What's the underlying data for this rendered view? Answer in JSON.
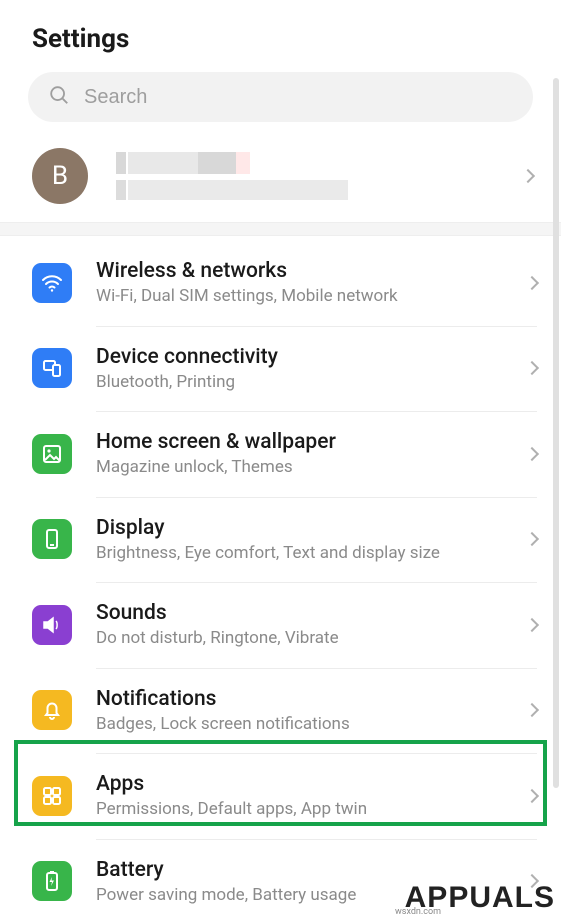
{
  "header": {
    "title": "Settings"
  },
  "search": {
    "placeholder": "Search"
  },
  "account": {
    "avatar_letter": "B"
  },
  "items": [
    {
      "id": "wireless",
      "title": "Wireless & networks",
      "sub": "Wi-Fi, Dual SIM settings, Mobile network",
      "color": "#2f7df6"
    },
    {
      "id": "device",
      "title": "Device connectivity",
      "sub": "Bluetooth, Printing",
      "color": "#2f7df6"
    },
    {
      "id": "home",
      "title": "Home screen & wallpaper",
      "sub": "Magazine unlock, Themes",
      "color": "#38b54a"
    },
    {
      "id": "display",
      "title": "Display",
      "sub": "Brightness, Eye comfort, Text and display size",
      "color": "#38b54a"
    },
    {
      "id": "sounds",
      "title": "Sounds",
      "sub": "Do not disturb, Ringtone, Vibrate",
      "color": "#8a3fd1"
    },
    {
      "id": "notifications",
      "title": "Notifications",
      "sub": "Badges, Lock screen notifications",
      "color": "#f5b921"
    },
    {
      "id": "apps",
      "title": "Apps",
      "sub": "Permissions, Default apps, App twin",
      "color": "#f5b921"
    },
    {
      "id": "battery",
      "title": "Battery",
      "sub": "Power saving mode, Battery usage",
      "color": "#38b54a"
    }
  ],
  "watermark": "APPUALS",
  "watermark_small": "wsxdn.com"
}
